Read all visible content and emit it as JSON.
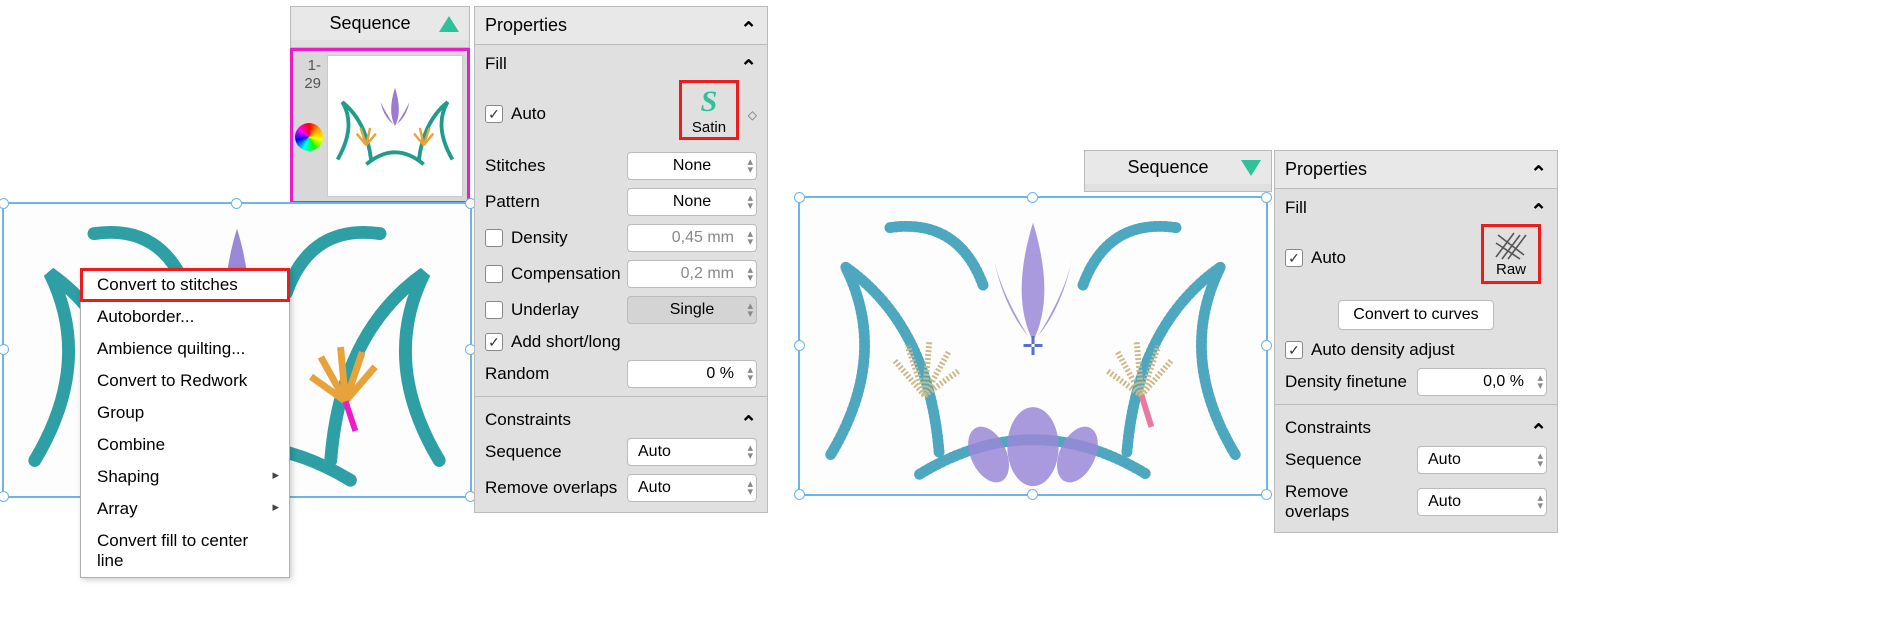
{
  "left": {
    "sequence_title": "Sequence",
    "thumb_range_a": "1-",
    "thumb_range_b": "29",
    "properties": {
      "panel_title": "Properties",
      "fill_title": "Fill",
      "auto_label": "Auto",
      "fill_type": "Satin",
      "stitches_label": "Stitches",
      "stitches_value": "None",
      "pattern_label": "Pattern",
      "pattern_value": "None",
      "density_label": "Density",
      "density_value": "0,45 mm",
      "compensation_label": "Compensation",
      "compensation_value": "0,2 mm",
      "underlay_label": "Underlay",
      "underlay_value": "Single",
      "shortlong_label": "Add short/long",
      "random_label": "Random",
      "random_value": "0 %",
      "constraints_title": "Constraints",
      "seq_label": "Sequence",
      "seq_value": "Auto",
      "overlaps_label": "Remove overlaps",
      "overlaps_value": "Auto"
    },
    "context_menu": [
      {
        "label": "Convert to stitches",
        "highlighted": true
      },
      {
        "label": "Autoborder..."
      },
      {
        "label": "Ambience quilting..."
      },
      {
        "label": "Convert to Redwork"
      },
      {
        "label": "Group"
      },
      {
        "label": "Combine"
      },
      {
        "label": "Shaping",
        "sub": true
      },
      {
        "label": "Array",
        "sub": true
      },
      {
        "label": "Convert fill to center line"
      }
    ]
  },
  "right": {
    "sequence_title": "Sequence",
    "properties": {
      "panel_title": "Properties",
      "fill_title": "Fill",
      "auto_label": "Auto",
      "fill_type": "Raw",
      "convert_btn": "Convert to curves",
      "auto_density_label": "Auto density adjust",
      "density_ft_label": "Density finetune",
      "density_ft_value": "0,0 %",
      "constraints_title": "Constraints",
      "seq_label": "Sequence",
      "seq_value": "Auto",
      "overlaps_label": "Remove overlaps",
      "overlaps_value": "Auto"
    }
  }
}
